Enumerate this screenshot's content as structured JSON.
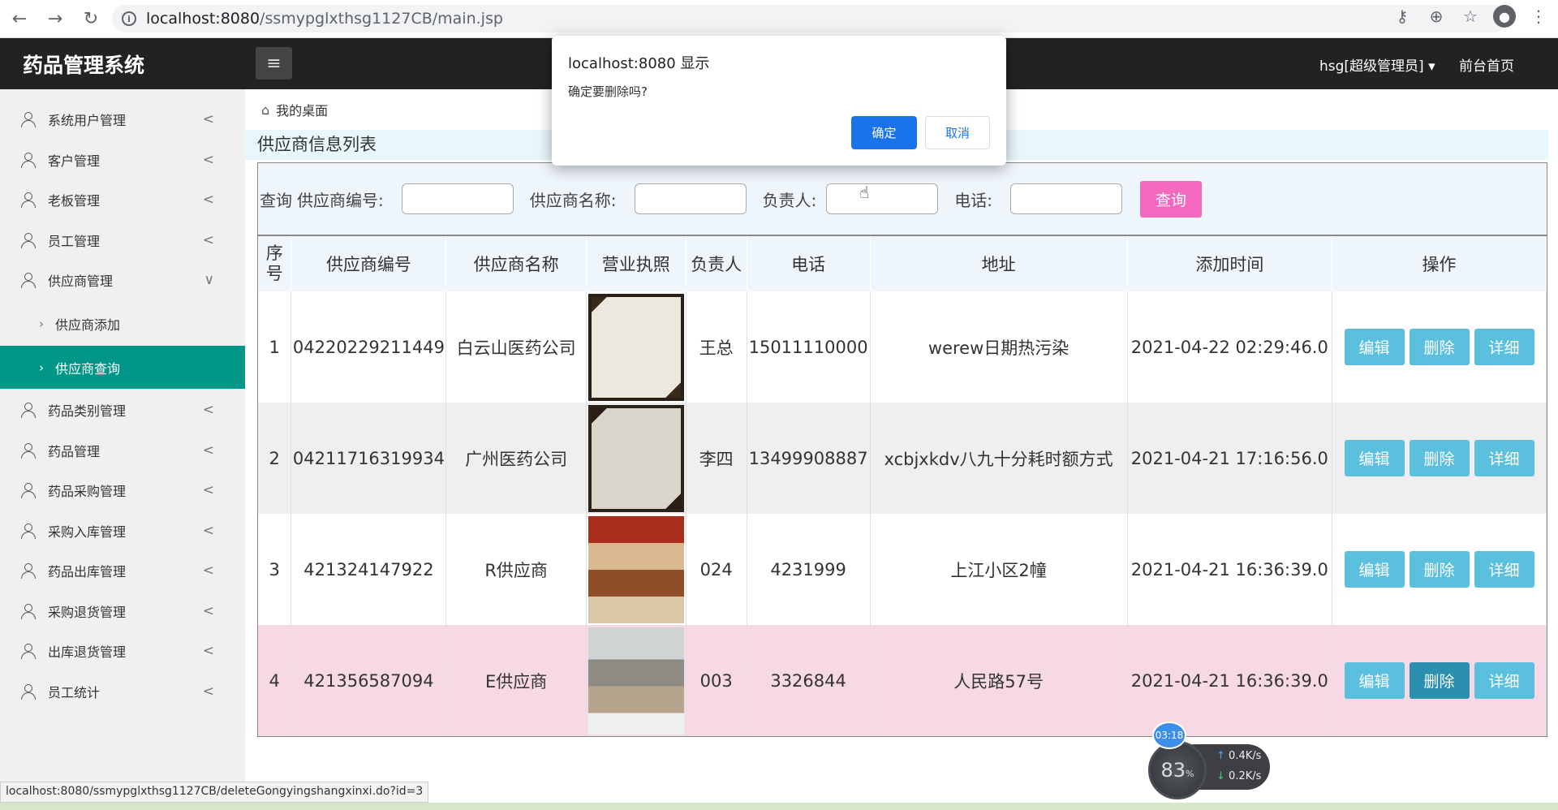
{
  "browser": {
    "url_host": "localhost:8080",
    "url_path": "/ssmypglxthsg1127CB/main.jsp",
    "status_url": "localhost:8080/ssmypglxthsg1127CB/deleteGongyingshangxinxi.do?id=3"
  },
  "header": {
    "app_title": "药品管理系统",
    "user_label": "hsg[超级管理员]",
    "front_link": "前台首页"
  },
  "sidebar": {
    "items": [
      {
        "label": "系统用户管理",
        "chev": "<"
      },
      {
        "label": "客户管理",
        "chev": "<"
      },
      {
        "label": "老板管理",
        "chev": "<"
      },
      {
        "label": "员工管理",
        "chev": "<"
      },
      {
        "label": "供应商管理",
        "chev": "∨"
      },
      {
        "label": "药品类别管理",
        "chev": "<"
      },
      {
        "label": "药品管理",
        "chev": "<"
      },
      {
        "label": "药品采购管理",
        "chev": "<"
      },
      {
        "label": "采购入库管理",
        "chev": "<"
      },
      {
        "label": "药品出库管理",
        "chev": "<"
      },
      {
        "label": "采购退货管理",
        "chev": "<"
      },
      {
        "label": "出库退货管理",
        "chev": "<"
      },
      {
        "label": "员工统计",
        "chev": "<"
      }
    ],
    "sub_items": [
      {
        "label": "供应商添加"
      },
      {
        "label": "供应商查询"
      }
    ]
  },
  "breadcrumb": {
    "label": "我的桌面"
  },
  "page": {
    "section_title": "供应商信息列表"
  },
  "search": {
    "prefix": "查询",
    "label_code": "供应商编号:",
    "label_name": "供应商名称:",
    "label_person": "负责人:",
    "label_phone": "电话:",
    "button": "查询"
  },
  "table": {
    "headers": [
      "序号",
      "供应商编号",
      "供应商名称",
      "营业执照",
      "负责人",
      "电话",
      "地址",
      "添加时间",
      "操作"
    ],
    "rows": [
      {
        "no": "1",
        "code": "04220229211449",
        "name": "白云山医药公司",
        "person": "王总",
        "phone": "15011110000",
        "address": "werew日期热污染",
        "time": "2021-04-22 02:29:46.0"
      },
      {
        "no": "2",
        "code": "04211716319934",
        "name": "广州医药公司",
        "person": "李四",
        "phone": "13499908887",
        "address": "xcbjxkdv八九十分耗时额方式",
        "time": "2021-04-21 17:16:56.0"
      },
      {
        "no": "3",
        "code": "421324147922",
        "name": "R供应商",
        "person": "024",
        "phone": "4231999",
        "address": "上江小区2幢",
        "time": "2021-04-21 16:36:39.0"
      },
      {
        "no": "4",
        "code": "421356587094",
        "name": "E供应商",
        "person": "003",
        "phone": "3326844",
        "address": "人民路57号",
        "time": "2021-04-21 16:36:39.0"
      }
    ],
    "actions": {
      "edit": "编辑",
      "delete": "删除",
      "detail": "详细"
    }
  },
  "dialog": {
    "title": "localhost:8080 显示",
    "message": "确定要删除吗?",
    "ok": "确定",
    "cancel": "取消"
  },
  "widget": {
    "time": "03:18",
    "percent": "83",
    "percent_unit": "%",
    "up_speed": "0.4",
    "down_speed": "0.2",
    "speed_unit": "K/s"
  },
  "colors": {
    "header_bg": "#222222",
    "active_menu": "#009688",
    "search_button": "#f568bf",
    "action_button": "#5bc0de",
    "dialog_primary": "#1a73e8"
  }
}
